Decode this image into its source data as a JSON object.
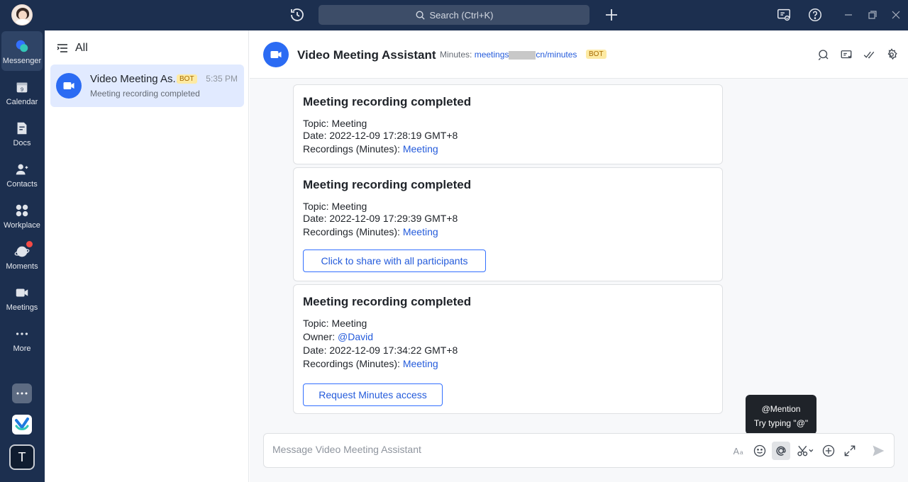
{
  "topbar": {
    "search_placeholder": "Search (Ctrl+K)"
  },
  "rail": {
    "items": [
      {
        "label": "Messenger"
      },
      {
        "label": "Calendar"
      },
      {
        "label": "Docs"
      },
      {
        "label": "Contacts"
      },
      {
        "label": "Workplace"
      },
      {
        "label": "Moments"
      },
      {
        "label": "Meetings"
      },
      {
        "label": "More"
      }
    ],
    "app_letter": "T"
  },
  "chatlist": {
    "header": "All",
    "chats": [
      {
        "name": "Video Meeting As...",
        "badge": "BOT",
        "time": "5:35 PM",
        "preview": "Meeting recording completed"
      }
    ]
  },
  "chat": {
    "title": "Video Meeting Assistant",
    "subtitle_prefix": "Minutes:",
    "subtitle_link_a": "meetings",
    "subtitle_link_b": "cn/minutes",
    "badge": "BOT"
  },
  "messages": [
    {
      "title": "Meeting recording completed",
      "topic": "Topic: Meeting",
      "date": "Date: 2022-12-09 17:28:19 GMT+8",
      "recordings_label": "Recordings (Minutes):",
      "recordings_link": "Meeting"
    },
    {
      "title": "Meeting recording completed",
      "topic": "Topic: Meeting",
      "date": "Date: 2022-12-09 17:29:39 GMT+8",
      "recordings_label": "Recordings (Minutes):",
      "recordings_link": "Meeting",
      "button": "Click to share with all participants"
    },
    {
      "title": "Meeting recording completed",
      "topic": "Topic: Meeting",
      "owner_label": "Owner:",
      "owner_link": "@David",
      "date": "Date: 2022-12-09 17:34:22 GMT+8",
      "recordings_label": "Recordings (Minutes):",
      "recordings_link": "Meeting",
      "button": "Request Minutes access"
    }
  ],
  "tooltip": {
    "line1": "@Mention",
    "line2": "Try typing \"@\""
  },
  "composer": {
    "placeholder": "Message Video Meeting Assistant"
  },
  "colors": {
    "nav_bg": "#1c2f4f",
    "accent": "#2b6bf3",
    "link": "#245bdb",
    "badge_bg": "#fdeaa3",
    "notification": "#f54a45"
  }
}
